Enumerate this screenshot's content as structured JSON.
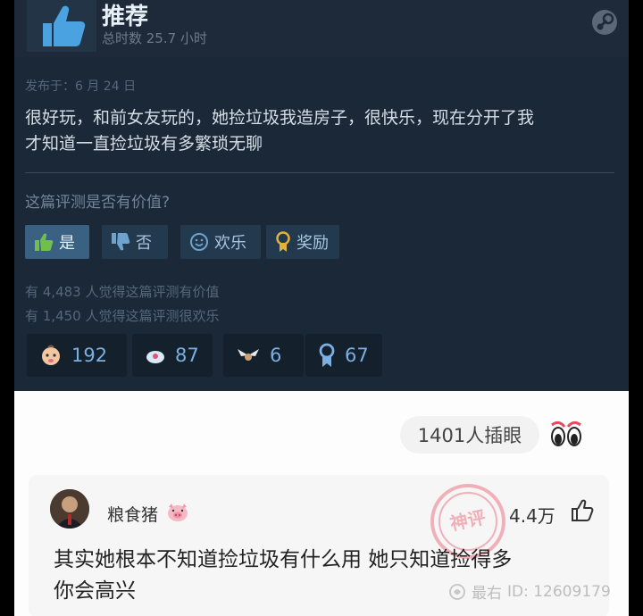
{
  "review": {
    "recommendation": "推荐",
    "playtime": "总时数 25.7 小时",
    "posted": "发布于：6 月 24 日",
    "text_line1": "很好玩，和前女友玩的，她捡垃圾我造房子，很快乐，现在分开了我",
    "text_line2": "才知道一直捡垃圾有多繁琐无聊",
    "helpful_question": "这篇评测是否有价值?",
    "buttons": {
      "yes": "是",
      "no": "否",
      "funny": "欢乐",
      "award": "奖励"
    },
    "stat_helpful": "有 4,483 人觉得这篇评测有价值",
    "stat_funny": "有 1,450 人觉得这篇评测很欢乐",
    "awards": [
      "192",
      "87",
      "6",
      "67"
    ]
  },
  "comment_section": {
    "people_count": "1401人插眼",
    "comment": {
      "username": "粮食猪",
      "likes": "4.4万",
      "text_line1": "其实她根本不知道捡垃圾有什么用 她只知道捡得多",
      "text_line2": "你会高兴"
    },
    "stamp_text": "神评",
    "watermark_name": "最右",
    "watermark_id": "ID: 12609179"
  },
  "colors": {
    "steam_bg": "#1b2838",
    "accent_blue": "#7ab0e2",
    "yes_button": "#3a6182",
    "stamp_red": "#e8304a"
  },
  "icons": [
    "thumbs-up-icon",
    "steam-logo-icon",
    "thumbs-down-icon",
    "smiley-icon",
    "award-ribbon-icon",
    "eyes-emoji-icon",
    "pig-emoji-icon",
    "like-hand-icon"
  ]
}
